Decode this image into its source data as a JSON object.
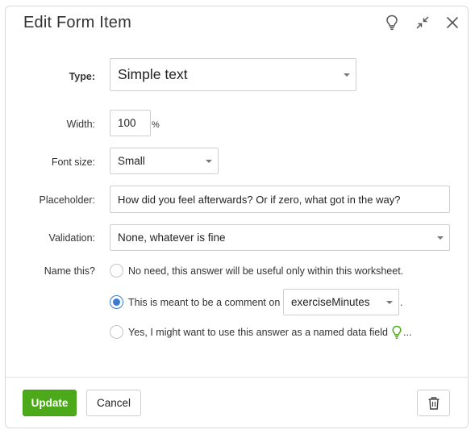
{
  "dialog": {
    "title": "Edit Form Item",
    "icons": {
      "tips": "lightbulb-icon",
      "collapse": "collapse-arrows-icon",
      "close": "close-icon"
    }
  },
  "form": {
    "type": {
      "label": "Type:",
      "value": "Simple text"
    },
    "width": {
      "label": "Width:",
      "value": "100",
      "unit": "%"
    },
    "font_size": {
      "label": "Font size:",
      "value": "Small"
    },
    "placeholder": {
      "label": "Placeholder:",
      "value": "How did you feel afterwards? Or if zero, what got in the way?"
    },
    "validation": {
      "label": "Validation:",
      "value": "None, whatever is fine"
    },
    "name_this": {
      "label": "Name this?",
      "options": [
        {
          "text": "No need, this answer will be useful only within this worksheet.",
          "checked": false
        },
        {
          "text": "This is meant to be a comment on",
          "checked": true,
          "select_value": "exerciseMinutes",
          "suffix": "."
        },
        {
          "text": "Yes, I might want to use this answer as a named data field",
          "checked": false,
          "suffix": "..."
        }
      ]
    }
  },
  "footer": {
    "update_label": "Update",
    "cancel_label": "Cancel",
    "delete_icon": "trash-icon"
  },
  "colors": {
    "primary": "#4caa1a",
    "radio_selected": "#3a7bd5",
    "hint_icon": "#4caa1a"
  }
}
